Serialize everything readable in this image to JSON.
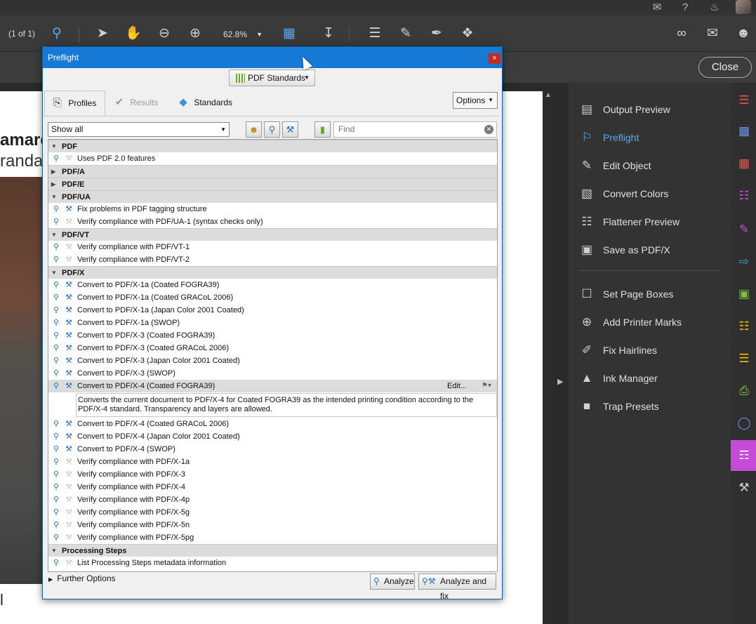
{
  "toolbar": {
    "page_counter": "(1 of 1)",
    "zoom": "62.8%"
  },
  "close_label": "Close",
  "document": {
    "line1": "amare",
    "line2": "randa",
    "line3": "l"
  },
  "tools_panel": {
    "items": [
      {
        "label": "Output Preview",
        "icon": "output-preview-icon"
      },
      {
        "label": "Preflight",
        "icon": "preflight-icon",
        "active": true
      },
      {
        "label": "Edit Object",
        "icon": "edit-object-icon"
      },
      {
        "label": "Convert Colors",
        "icon": "convert-colors-icon"
      },
      {
        "label": "Flattener Preview",
        "icon": "flattener-preview-icon"
      },
      {
        "label": "Save as PDF/X",
        "icon": "save-as-pdfx-icon"
      },
      {
        "label": "Set Page Boxes",
        "icon": "set-page-boxes-icon"
      },
      {
        "label": "Add Printer Marks",
        "icon": "add-printer-marks-icon"
      },
      {
        "label": "Fix Hairlines",
        "icon": "fix-hairlines-icon"
      },
      {
        "label": "Ink Manager",
        "icon": "ink-manager-icon"
      },
      {
        "label": "Trap Presets",
        "icon": "trap-presets-icon"
      }
    ]
  },
  "dialog": {
    "title": "Preflight",
    "close_glyph": "×",
    "standards_button": "PDF Standards",
    "tabs": {
      "profiles": "Profiles",
      "results": "Results",
      "standards": "Standards"
    },
    "options_button": "Options",
    "filter": {
      "show_all": "Show all",
      "find_placeholder": "Find"
    },
    "groups": [
      {
        "name": "PDF",
        "expanded": true,
        "items": [
          {
            "label": "Uses PDF 2.0 features",
            "fixup": false
          }
        ]
      },
      {
        "name": "PDF/A",
        "expanded": false,
        "items": []
      },
      {
        "name": "PDF/E",
        "expanded": false,
        "items": []
      },
      {
        "name": "PDF/UA",
        "expanded": true,
        "items": [
          {
            "label": "Fix problems in PDF tagging structure",
            "fixup": true
          },
          {
            "label": "Verify compliance with PDF/UA-1 (syntax checks only)",
            "fixup": false
          }
        ]
      },
      {
        "name": "PDF/VT",
        "expanded": true,
        "items": [
          {
            "label": "Verify compliance with PDF/VT-1",
            "fixup": false
          },
          {
            "label": "Verify compliance with PDF/VT-2",
            "fixup": false
          }
        ]
      },
      {
        "name": "PDF/X",
        "expanded": true,
        "items": [
          {
            "label": "Convert to PDF/X-1a (Coated FOGRA39)",
            "fixup": true
          },
          {
            "label": "Convert to PDF/X-1a (Coated GRACoL 2006)",
            "fixup": true
          },
          {
            "label": "Convert to PDF/X-1a (Japan Color 2001 Coated)",
            "fixup": true
          },
          {
            "label": "Convert to PDF/X-1a (SWOP)",
            "fixup": true
          },
          {
            "label": "Convert to PDF/X-3 (Coated FOGRA39)",
            "fixup": true
          },
          {
            "label": "Convert to PDF/X-3 (Coated GRACoL 2006)",
            "fixup": true
          },
          {
            "label": "Convert to PDF/X-3 (Japan Color 2001 Coated)",
            "fixup": true
          },
          {
            "label": "Convert to PDF/X-3 (SWOP)",
            "fixup": true
          },
          {
            "label": "Convert to PDF/X-4 (Coated FOGRA39)",
            "fixup": true,
            "selected": true
          },
          {
            "label": "Convert to PDF/X-4 (Coated GRACoL 2006)",
            "fixup": true
          },
          {
            "label": "Convert to PDF/X-4 (Japan Color 2001 Coated)",
            "fixup": true
          },
          {
            "label": "Convert to PDF/X-4 (SWOP)",
            "fixup": true
          },
          {
            "label": "Verify compliance with PDF/X-1a",
            "fixup": false
          },
          {
            "label": "Verify compliance with PDF/X-3",
            "fixup": false
          },
          {
            "label": "Verify compliance with PDF/X-4",
            "fixup": false
          },
          {
            "label": "Verify compliance with PDF/X-4p",
            "fixup": false
          },
          {
            "label": "Verify compliance with PDF/X-5g",
            "fixup": false
          },
          {
            "label": "Verify compliance with PDF/X-5n",
            "fixup": false
          },
          {
            "label": "Verify compliance with PDF/X-5pg",
            "fixup": false
          }
        ]
      },
      {
        "name": "Processing Steps",
        "expanded": true,
        "items": [
          {
            "label": "List Processing Steps metadata information",
            "fixup": false
          }
        ]
      }
    ],
    "selected_edit": "Edit...",
    "selected_description": "Converts the current document to PDF/X-4 for Coated FOGRA39 as the intended printing condition according to the PDF/X-4 standard. Transparency and layers are allowed.",
    "further_options": "Further Options",
    "analyze_button": "Analyze",
    "analyze_fix_button": "Analyze and fix"
  },
  "colors": {
    "accent": "#1679d6",
    "active_tool": "#5fa6ef",
    "active_side": "#c54bd8"
  }
}
